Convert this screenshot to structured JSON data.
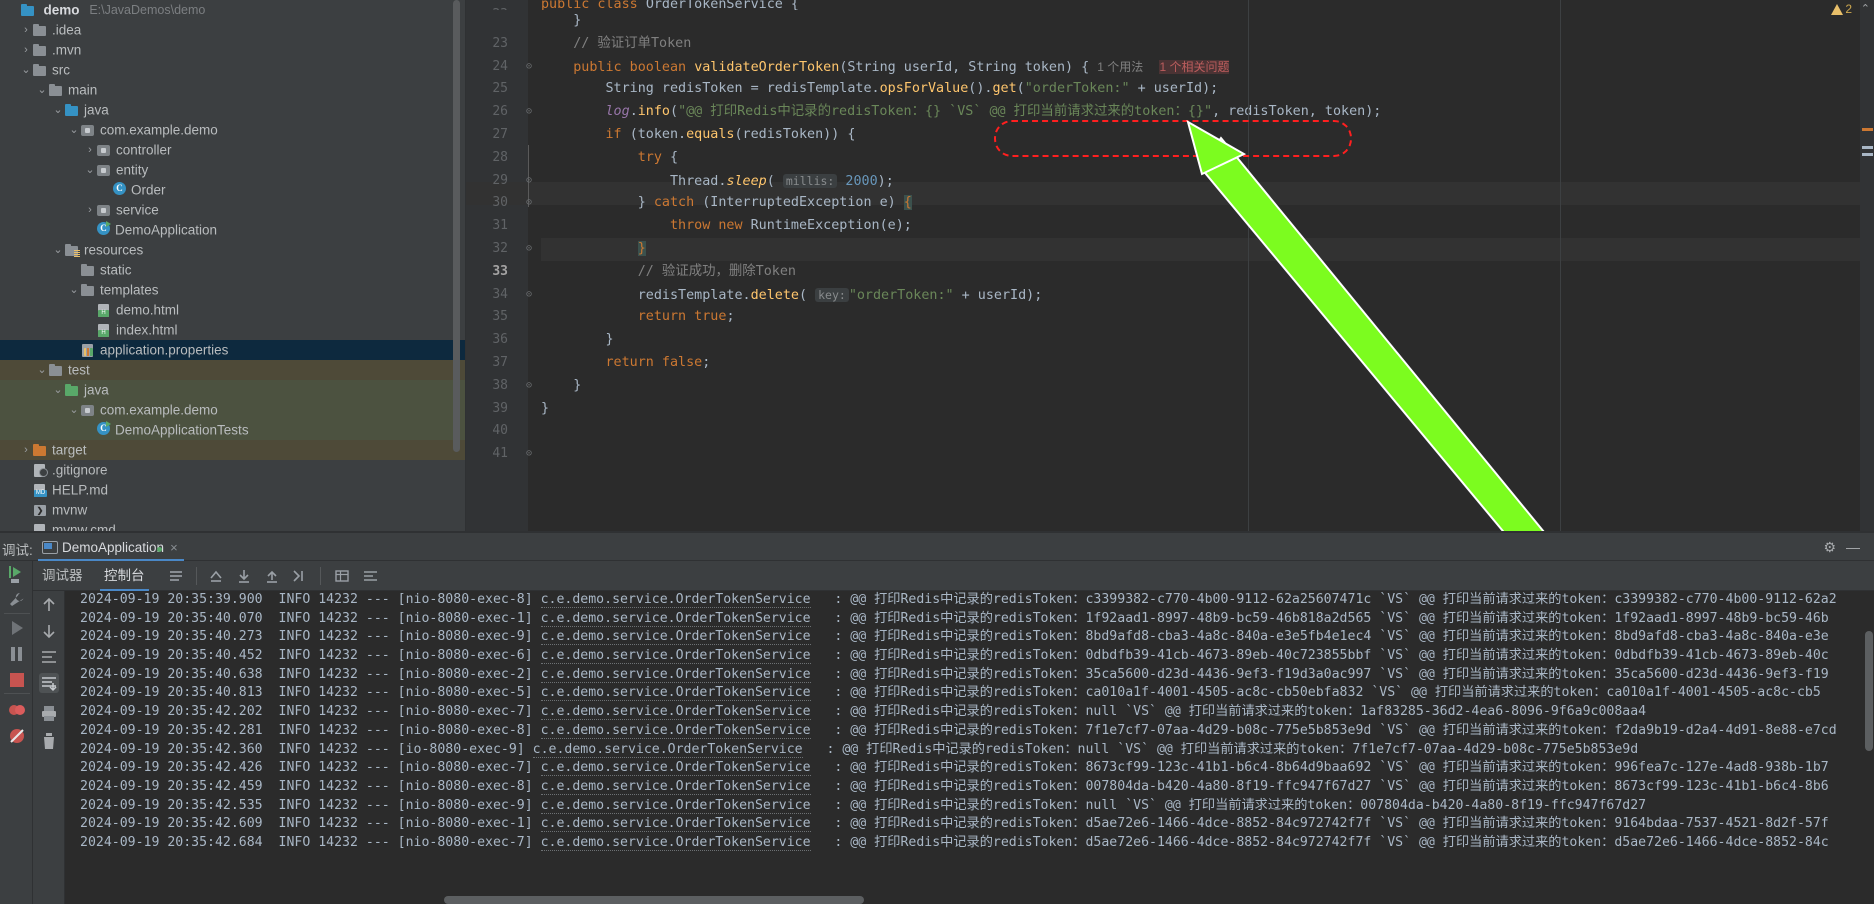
{
  "project": {
    "title": "demo",
    "path": "E:\\JavaDemos\\demo",
    "items": [
      {
        "label": ".idea",
        "indent": 1,
        "arrow": "right",
        "icon": "folder",
        "state": "none"
      },
      {
        "label": ".mvn",
        "indent": 1,
        "arrow": "right",
        "icon": "folder",
        "state": "none"
      },
      {
        "label": "src",
        "indent": 1,
        "arrow": "down",
        "icon": "folder",
        "state": "none"
      },
      {
        "label": "main",
        "indent": 2,
        "arrow": "down",
        "icon": "folder",
        "state": "none"
      },
      {
        "label": "java",
        "indent": 3,
        "arrow": "down",
        "icon": "folder-blue",
        "state": "none"
      },
      {
        "label": "com.example.demo",
        "indent": 4,
        "arrow": "down",
        "icon": "package",
        "state": "none"
      },
      {
        "label": "controller",
        "indent": 5,
        "arrow": "right",
        "icon": "package",
        "state": "none"
      },
      {
        "label": "entity",
        "indent": 5,
        "arrow": "down",
        "icon": "package",
        "state": "none"
      },
      {
        "label": "Order",
        "indent": 6,
        "arrow": "none",
        "icon": "class",
        "state": "none"
      },
      {
        "label": "service",
        "indent": 5,
        "arrow": "right",
        "icon": "package",
        "state": "none"
      },
      {
        "label": "DemoApplication",
        "indent": 5,
        "arrow": "none",
        "icon": "class-run",
        "state": "none"
      },
      {
        "label": "resources",
        "indent": 3,
        "arrow": "down",
        "icon": "folder-res",
        "state": "none"
      },
      {
        "label": "static",
        "indent": 4,
        "arrow": "none",
        "icon": "folder",
        "state": "none"
      },
      {
        "label": "templates",
        "indent": 4,
        "arrow": "down",
        "icon": "folder",
        "state": "none"
      },
      {
        "label": "demo.html",
        "indent": 5,
        "arrow": "none",
        "icon": "html",
        "state": "none"
      },
      {
        "label": "index.html",
        "indent": 5,
        "arrow": "none",
        "icon": "html",
        "state": "none"
      },
      {
        "label": "application.properties",
        "indent": 4,
        "arrow": "none",
        "icon": "props",
        "state": "selected-blue"
      },
      {
        "label": "test",
        "indent": 2,
        "arrow": "down",
        "icon": "folder",
        "state": "hl-olive"
      },
      {
        "label": "java",
        "indent": 3,
        "arrow": "down",
        "icon": "folder-green",
        "state": "hl-green"
      },
      {
        "label": "com.example.demo",
        "indent": 4,
        "arrow": "down",
        "icon": "package",
        "state": "hl-green"
      },
      {
        "label": "DemoApplicationTests",
        "indent": 5,
        "arrow": "none",
        "icon": "class-run",
        "state": "hl-green"
      },
      {
        "label": "target",
        "indent": 1,
        "arrow": "right",
        "icon": "folder-orange",
        "state": "hl-olive"
      },
      {
        "label": ".gitignore",
        "indent": 1,
        "arrow": "none",
        "icon": "gitignore",
        "state": "none"
      },
      {
        "label": "HELP.md",
        "indent": 1,
        "arrow": "none",
        "icon": "markdown",
        "state": "none"
      },
      {
        "label": "mvnw",
        "indent": 1,
        "arrow": "none",
        "icon": "shell",
        "state": "none"
      },
      {
        "label": "mvnw.cmd",
        "indent": 1,
        "arrow": "none",
        "icon": "markdown-plain",
        "state": "none"
      }
    ]
  },
  "editor": {
    "warning_count": "2",
    "warning_chevron": "⌃",
    "lines": [
      {
        "num": "23",
        "fold": "",
        "current": false
      },
      {
        "num": "24",
        "fold": "",
        "current": false
      },
      {
        "num": "25",
        "fold": "⊖",
        "current": false
      },
      {
        "num": "26",
        "fold": "",
        "current": false
      },
      {
        "num": "27",
        "fold": "",
        "current": false
      },
      {
        "num": "28",
        "fold": "⊖",
        "current": false
      },
      {
        "num": "29",
        "fold": "⊖",
        "current": false
      },
      {
        "num": "30",
        "fold": "",
        "current": false
      },
      {
        "num": "31",
        "fold": "⊖",
        "current": false
      },
      {
        "num": "32",
        "fold": "",
        "current": false
      },
      {
        "num": "33",
        "fold": "⊖",
        "current": true
      },
      {
        "num": "34",
        "fold": "",
        "current": false
      },
      {
        "num": "35",
        "fold": "",
        "current": false
      },
      {
        "num": "36",
        "fold": "",
        "current": false
      },
      {
        "num": "37",
        "fold": "⊖",
        "current": false
      },
      {
        "num": "38",
        "fold": "",
        "current": false
      },
      {
        "num": "39",
        "fold": "",
        "current": false
      },
      {
        "num": "40",
        "fold": "",
        "current": false
      },
      {
        "num": "41",
        "fold": "",
        "current": false
      }
    ],
    "header_line": "public class OrderTokenService {",
    "code": {
      "l24_comment": "// 验证订单Token",
      "l25_usage": "1 个用法",
      "l25_problem": "1 个相关问题",
      "l27_string": "\"@@ 打印Redis中记录的redisToken：{} `VS` @@ 打印当前请求过来的token：{}\"",
      "l30_hint": "millis:",
      "l30_value": "2000",
      "l34_comment": "// 验证成功，删除Token",
      "l35_hint": "key:",
      "l35_string": "\"orderToken:\""
    }
  },
  "debug": {
    "panel_label": "调试:",
    "tab_title": "DemoApplication",
    "tab_close": "×",
    "tabs": [
      {
        "label": "调试器",
        "active": false
      },
      {
        "label": "控制台",
        "active": true
      }
    ],
    "gear_icon": "⚙",
    "minimize_icon": "—",
    "toolbar_icons": [
      "menu-icon",
      "rerun-icon",
      "step-down-icon",
      "step-up-icon",
      "step-out-icon",
      "table-icon",
      "soft-wrap-icon"
    ],
    "rail_icons": [
      "scroll-up-icon",
      "scroll-down-icon",
      "soft-wrap-icon",
      "scroll-to-end-icon",
      "print-icon",
      "clear-all-icon"
    ],
    "log_lines": [
      {
        "ts": "2024-09-19 20:35:39.900",
        "level": "INFO",
        "pid": "14232",
        "sep": "---",
        "thread": "[nio-8080-exec-8]",
        "cls": "c.e.demo.service.OrderTokenService",
        "msg": ": @@ 打印Redis中记录的redisToken：c3399382-c770-4b00-9112-62a25607471c `VS` @@ 打印当前请求过来的token：c3399382-c770-4b00-9112-62a2"
      },
      {
        "ts": "2024-09-19 20:35:40.070",
        "level": "INFO",
        "pid": "14232",
        "sep": "---",
        "thread": "[nio-8080-exec-1]",
        "cls": "c.e.demo.service.OrderTokenService",
        "msg": ": @@ 打印Redis中记录的redisToken：1f92aad1-8997-48b9-bc59-46b818a2d565 `VS` @@ 打印当前请求过来的token：1f92aad1-8997-48b9-bc59-46b"
      },
      {
        "ts": "2024-09-19 20:35:40.273",
        "level": "INFO",
        "pid": "14232",
        "sep": "---",
        "thread": "[nio-8080-exec-9]",
        "cls": "c.e.demo.service.OrderTokenService",
        "msg": ": @@ 打印Redis中记录的redisToken：8bd9afd8-cba3-4a8c-840a-e3e5fb4e1ec4 `VS` @@ 打印当前请求过来的token：8bd9afd8-cba3-4a8c-840a-e3e"
      },
      {
        "ts": "2024-09-19 20:35:40.452",
        "level": "INFO",
        "pid": "14232",
        "sep": "---",
        "thread": "[nio-8080-exec-6]",
        "cls": "c.e.demo.service.OrderTokenService",
        "msg": ": @@ 打印Redis中记录的redisToken：0dbdfb39-41cb-4673-89eb-40c723855bbf `VS` @@ 打印当前请求过来的token：0dbdfb39-41cb-4673-89eb-40c"
      },
      {
        "ts": "2024-09-19 20:35:40.638",
        "level": "INFO",
        "pid": "14232",
        "sep": "---",
        "thread": "[nio-8080-exec-2]",
        "cls": "c.e.demo.service.OrderTokenService",
        "msg": ": @@ 打印Redis中记录的redisToken：35ca5600-d23d-4436-9ef3-f19d3a0ac997 `VS` @@ 打印当前请求过来的token：35ca5600-d23d-4436-9ef3-f19"
      },
      {
        "ts": "2024-09-19 20:35:40.813",
        "level": "INFO",
        "pid": "14232",
        "sep": "---",
        "thread": "[nio-8080-exec-5]",
        "cls": "c.e.demo.service.OrderTokenService",
        "msg": ": @@ 打印Redis中记录的redisToken：ca010a1f-4001-4505-ac8c-cb50ebfa832 `VS` @@ 打印当前请求过来的token：ca010a1f-4001-4505-ac8c-cb5"
      },
      {
        "ts": "2024-09-19 20:35:42.202",
        "level": "INFO",
        "pid": "14232",
        "sep": "---",
        "thread": "[nio-8080-exec-7]",
        "cls": "c.e.demo.service.OrderTokenService",
        "msg": ": @@ 打印Redis中记录的redisToken：null `VS` @@ 打印当前请求过来的token：1af83285-36d2-4ea6-8096-9f6a9c008aa4"
      },
      {
        "ts": "2024-09-19 20:35:42.281",
        "level": "INFO",
        "pid": "14232",
        "sep": "---",
        "thread": "[nio-8080-exec-8]",
        "cls": "c.e.demo.service.OrderTokenService",
        "msg": ": @@ 打印Redis中记录的redisToken：7f1e7cf7-07aa-4d29-b08c-775e5b853e9d `VS` @@ 打印当前请求过来的token：f2da9b19-d2a4-4d91-8e88-e7cd"
      },
      {
        "ts": "2024-09-19 20:35:42.360",
        "level": "INFO",
        "pid": "14232",
        "sep": "---",
        "thread": "[io-8080-exec-9]",
        "cls": "c.e.demo.service.OrderTokenService",
        "msg": ": @@ 打印Redis中记录的redisToken：null `VS` @@ 打印当前请求过来的token：7f1e7cf7-07aa-4d29-b08c-775e5b853e9d"
      },
      {
        "ts": "2024-09-19 20:35:42.426",
        "level": "INFO",
        "pid": "14232",
        "sep": "---",
        "thread": "[nio-8080-exec-7]",
        "cls": "c.e.demo.service.OrderTokenService",
        "msg": ": @@ 打印Redis中记录的redisToken：8673cf99-123c-41b1-b6c4-8b64d9baa692 `VS` @@ 打印当前请求过来的token：996fea7c-127e-4ad8-938b-1b7"
      },
      {
        "ts": "2024-09-19 20:35:42.459",
        "level": "INFO",
        "pid": "14232",
        "sep": "---",
        "thread": "[nio-8080-exec-8]",
        "cls": "c.e.demo.service.OrderTokenService",
        "msg": ": @@ 打印Redis中记录的redisToken：007804da-b420-4a80-8f19-ffc947f67d27 `VS` @@ 打印当前请求过来的token：8673cf99-123c-41b1-b6c4-8b6"
      },
      {
        "ts": "2024-09-19 20:35:42.535",
        "level": "INFO",
        "pid": "14232",
        "sep": "---",
        "thread": "[nio-8080-exec-9]",
        "cls": "c.e.demo.service.OrderTokenService",
        "msg": ": @@ 打印Redis中记录的redisToken：null `VS` @@ 打印当前请求过来的token：007804da-b420-4a80-8f19-ffc947f67d27"
      },
      {
        "ts": "2024-09-19 20:35:42.609",
        "level": "INFO",
        "pid": "14232",
        "sep": "---",
        "thread": "[nio-8080-exec-1]",
        "cls": "c.e.demo.service.OrderTokenService",
        "msg": ": @@ 打印Redis中记录的redisToken：d5ae72e6-1466-4dce-8852-84c972742f7f `VS` @@ 打印当前请求过来的token：9164bdaa-7537-4521-8d2f-57f"
      },
      {
        "ts": "2024-09-19 20:35:42.684",
        "level": "INFO",
        "pid": "14232",
        "sep": "---",
        "thread": "[nio-8080-exec-7]",
        "cls": "c.e.demo.service.OrderTokenService",
        "msg": ": @@ 打印Redis中记录的redisToken：d5ae72e6-1466-4dce-8852-84c972742f7f `VS` @@ 打印当前请求过来的token：d5ae72e6-1466-4dce-8852-84c"
      }
    ]
  },
  "colors": {
    "accent_blue": "#4a88c7",
    "annotation_red": "#ff1f1f",
    "annotation_green": "#7cfc1f",
    "editor_bg": "#2b2b2b",
    "panel_bg": "#3c3f41"
  }
}
